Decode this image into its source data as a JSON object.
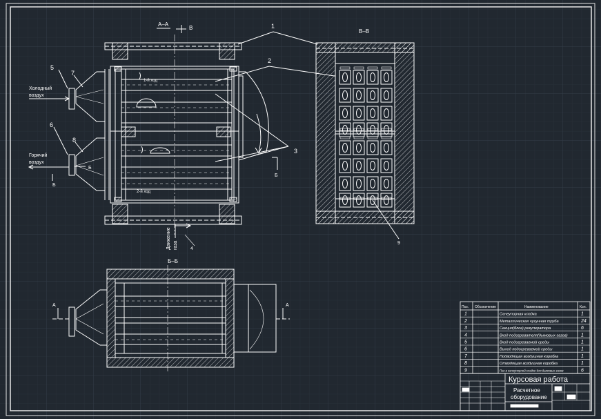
{
  "colors": {
    "background": "#212830",
    "grid": "#2e3742",
    "line": "#ffffff",
    "frame": "#e8e8e8"
  },
  "views": {
    "section_aa_label": "А–А",
    "section_aa_arrow": "В",
    "section_vv_label": "В–В",
    "section_bb_label": "Б–Б"
  },
  "labels": {
    "cold_air": [
      "Холодный",
      "воздух"
    ],
    "hot_air": [
      "Горячий",
      "воздух"
    ],
    "gas_movement": [
      "Движение",
      "газа"
    ],
    "pass_1": "1-й ход",
    "pass_2": "2-й ход",
    "cut_a": "А",
    "cut_b": "Б",
    "cut_v": "В"
  },
  "callouts": [
    "1",
    "2",
    "3",
    "4",
    "5",
    "6",
    "7",
    "8",
    "9"
  ],
  "spec_table": {
    "headers": [
      "Поз.",
      "Обозначение",
      "Наименование",
      "Кол."
    ],
    "rows": [
      {
        "pos": "1",
        "name": "Огнеупорная кладка",
        "qty": "1"
      },
      {
        "pos": "2",
        "name": "Металлическая чугунная труба",
        "qty": "24"
      },
      {
        "pos": "3",
        "name": "Секция(блок) рекуператора",
        "qty": "6"
      },
      {
        "pos": "4",
        "name": "Вход подогревателя(дымовых газов)",
        "qty": "1"
      },
      {
        "pos": "5",
        "name": "Вход подогреваемой среды",
        "qty": "1"
      },
      {
        "pos": "6",
        "name": "Выход подогреваемой среды",
        "qty": "1"
      },
      {
        "pos": "7",
        "name": "Подводящая воздушная коробка",
        "qty": "1"
      },
      {
        "pos": "8",
        "name": "Отводящая воздушная коробка",
        "qty": "1"
      },
      {
        "pos": "9",
        "name": "Паз в огнеупорной кладке для дымовых газов",
        "qty": "6"
      }
    ]
  },
  "title_block": {
    "title": "Курсовая работа",
    "subtitle_line1": "Расчетное",
    "subtitle_line2": "оборудование"
  }
}
